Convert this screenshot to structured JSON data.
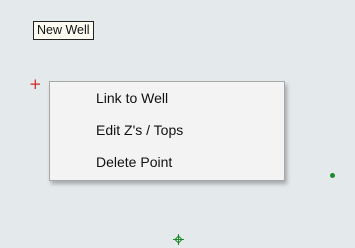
{
  "well_label": "New Well",
  "context_menu": {
    "items": [
      {
        "label": "Link to Well"
      },
      {
        "label": "Edit Z's / Tops"
      },
      {
        "label": "Delete Point"
      }
    ]
  },
  "markers": {
    "red_point_icon": "plus-marker",
    "green_point_icon": "dot-marker",
    "green_target_icon": "crosshair-diamond-marker"
  },
  "colors": {
    "canvas_background": "#e4e9ec",
    "red_marker": "#d42626",
    "green_marker": "#1d8a2a",
    "menu_background": "#f3f3f3"
  }
}
